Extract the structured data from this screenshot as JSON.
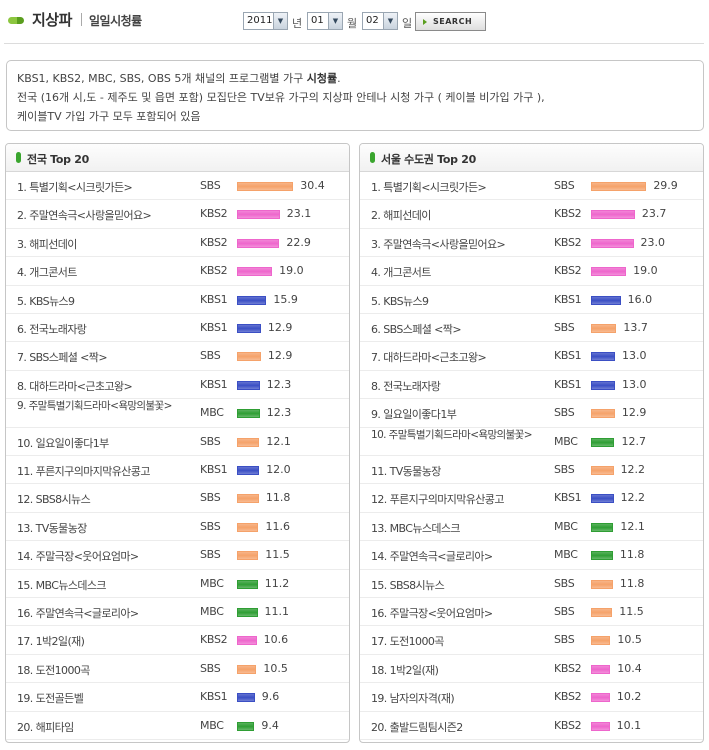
{
  "header": {
    "title": "지상파",
    "subtitle": "일일시청률",
    "year": "2011",
    "year_label": "년",
    "month": "01",
    "month_label": "월",
    "day": "02",
    "day_label": "일",
    "search_label": "SEARCH"
  },
  "notice": {
    "line1_prefix": "KBS1, KBS2, MBC, SBS, OBS 5개 채널의 프로그램별 가구 ",
    "line1_bold": "시청률",
    "line1_suffix": ".",
    "line2": "전국 (16개 시,도 - 제주도 및 읍면 포함) 모집단은 TV보유 가구의 지상파 안테나 시청 가구 ( 케이블 비가입 가구 ),",
    "line3": "케이블TV 가입 가구 모두 포함되어 있음"
  },
  "colors": {
    "SBS": "#f5a26a",
    "KBS2": "#ee66cc",
    "KBS1": "#3b4fc4",
    "MBC": "#2f9e34"
  },
  "panels": [
    {
      "title": "전국 Top 20",
      "rows": [
        {
          "rank": "1.",
          "name": "특별기획<시크릿가든>",
          "channel": "SBS",
          "value": 30.4
        },
        {
          "rank": "2.",
          "name": "주말연속극<사랑을믿어요>",
          "channel": "KBS2",
          "value": 23.1
        },
        {
          "rank": "3.",
          "name": "해피선데이",
          "channel": "KBS2",
          "value": 22.9
        },
        {
          "rank": "4.",
          "name": "개그콘서트",
          "channel": "KBS2",
          "value": 19.0
        },
        {
          "rank": "5.",
          "name": "KBS뉴스9",
          "channel": "KBS1",
          "value": 15.9
        },
        {
          "rank": "6.",
          "name": "전국노래자랑",
          "channel": "KBS1",
          "value": 12.9
        },
        {
          "rank": "7.",
          "name": "SBS스페셜 <짝>",
          "channel": "SBS",
          "value": 12.9
        },
        {
          "rank": "8.",
          "name": "대하드라마<근초고왕>",
          "channel": "KBS1",
          "value": 12.3
        },
        {
          "rank": "9.",
          "name": "주말특별기획드라마<욕망의불꽃>",
          "channel": "MBC",
          "value": 12.3
        },
        {
          "rank": "10.",
          "name": "일요일이좋다1부",
          "channel": "SBS",
          "value": 12.1
        },
        {
          "rank": "11.",
          "name": "푸른지구의마지막유산콩고",
          "channel": "KBS1",
          "value": 12.0
        },
        {
          "rank": "12.",
          "name": "SBS8시뉴스",
          "channel": "SBS",
          "value": 11.8
        },
        {
          "rank": "13.",
          "name": "TV동물농장",
          "channel": "SBS",
          "value": 11.6
        },
        {
          "rank": "14.",
          "name": "주말극장<웃어요엄마>",
          "channel": "SBS",
          "value": 11.5
        },
        {
          "rank": "15.",
          "name": "MBC뉴스데스크",
          "channel": "MBC",
          "value": 11.2
        },
        {
          "rank": "16.",
          "name": "주말연속극<글로리아>",
          "channel": "MBC",
          "value": 11.1
        },
        {
          "rank": "17.",
          "name": "1박2일(재)",
          "channel": "KBS2",
          "value": 10.6
        },
        {
          "rank": "18.",
          "name": "도전1000곡",
          "channel": "SBS",
          "value": 10.5
        },
        {
          "rank": "19.",
          "name": "도전골든벨",
          "channel": "KBS1",
          "value": 9.6
        },
        {
          "rank": "20.",
          "name": "해피타임",
          "channel": "MBC",
          "value": 9.4
        }
      ]
    },
    {
      "title": "서울 수도권 Top 20",
      "rows": [
        {
          "rank": "1.",
          "name": "특별기획<시크릿가든>",
          "channel": "SBS",
          "value": 29.9
        },
        {
          "rank": "2.",
          "name": "해피선데이",
          "channel": "KBS2",
          "value": 23.7
        },
        {
          "rank": "3.",
          "name": "주말연속극<사랑을믿어요>",
          "channel": "KBS2",
          "value": 23.0
        },
        {
          "rank": "4.",
          "name": "개그콘서트",
          "channel": "KBS2",
          "value": 19.0
        },
        {
          "rank": "5.",
          "name": "KBS뉴스9",
          "channel": "KBS1",
          "value": 16.0
        },
        {
          "rank": "6.",
          "name": "SBS스페셜 <짝>",
          "channel": "SBS",
          "value": 13.7
        },
        {
          "rank": "7.",
          "name": "대하드라마<근초고왕>",
          "channel": "KBS1",
          "value": 13.0
        },
        {
          "rank": "8.",
          "name": "전국노래자랑",
          "channel": "KBS1",
          "value": 13.0
        },
        {
          "rank": "9.",
          "name": "일요일이좋다1부",
          "channel": "SBS",
          "value": 12.9
        },
        {
          "rank": "10.",
          "name": "주말특별기획드라마<욕망의불꽃>",
          "channel": "MBC",
          "value": 12.7
        },
        {
          "rank": "11.",
          "name": "TV동물농장",
          "channel": "SBS",
          "value": 12.2
        },
        {
          "rank": "12.",
          "name": "푸른지구의마지막유산콩고",
          "channel": "KBS1",
          "value": 12.2
        },
        {
          "rank": "13.",
          "name": "MBC뉴스데스크",
          "channel": "MBC",
          "value": 12.1
        },
        {
          "rank": "14.",
          "name": "주말연속극<글로리아>",
          "channel": "MBC",
          "value": 11.8
        },
        {
          "rank": "15.",
          "name": "SBS8시뉴스",
          "channel": "SBS",
          "value": 11.8
        },
        {
          "rank": "16.",
          "name": "주말극장<웃어요엄마>",
          "channel": "SBS",
          "value": 11.5
        },
        {
          "rank": "17.",
          "name": "도전1000곡",
          "channel": "SBS",
          "value": 10.5
        },
        {
          "rank": "18.",
          "name": "1박2일(재)",
          "channel": "KBS2",
          "value": 10.4
        },
        {
          "rank": "19.",
          "name": "남자의자격(재)",
          "channel": "KBS2",
          "value": 10.2
        },
        {
          "rank": "20.",
          "name": "출발드림팀시즌2",
          "channel": "KBS2",
          "value": 10.1
        }
      ]
    }
  ]
}
